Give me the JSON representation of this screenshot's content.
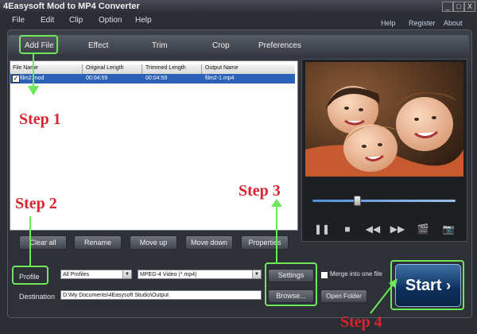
{
  "window": {
    "title": "4Easysoft Mod to MP4 Converter",
    "buttons": [
      "_",
      "□",
      "X"
    ]
  },
  "menu": {
    "items": [
      "File",
      "Edit",
      "Clip",
      "Option",
      "Help"
    ],
    "right_links": [
      "Help",
      "Register",
      "About"
    ]
  },
  "tabs": [
    "Add File",
    "Effect",
    "Trim",
    "Crop",
    "Preferences"
  ],
  "file_list": {
    "columns": [
      "File Name",
      "Original Length",
      "Trimmed Length",
      "Output Name"
    ],
    "rows": [
      {
        "name": "film2.mod",
        "original": "00:04:59",
        "trimmed": "00:04:59",
        "output": "film2-1.mp4",
        "checked": true
      }
    ]
  },
  "list_buttons": [
    "Clear all",
    "Rename",
    "Move up",
    "Move down",
    "Properties"
  ],
  "player": {
    "controls": [
      "pause-icon",
      "stop-icon",
      "rewind-icon",
      "forward-icon",
      "clip-icon",
      "camera-icon"
    ],
    "glyphs": {
      "pause": "❚❚",
      "stop": "■",
      "rewind": "◀◀",
      "forward": "▶▶",
      "clip": "🎬",
      "camera": "📷"
    }
  },
  "profile": {
    "label": "Profile",
    "category": "All Profiles",
    "format": "MPEG-4 Video (*.mp4)",
    "settings_label": "Settings",
    "merge_label": "Merge into one file"
  },
  "destination": {
    "label": "Destination",
    "path": "D:\\My Documents\\4Easysoft Studio\\Output",
    "browse_label": "Browse...",
    "open_folder_label": "Open Folder"
  },
  "start_label": "Start",
  "start_arrow": "›",
  "annotations": {
    "step1": "Step 1",
    "step2": "Step 2",
    "step3": "Step 3",
    "step4": "Step 4",
    "highlight_color": "#6ee85b",
    "step_color": "#d9232f"
  }
}
